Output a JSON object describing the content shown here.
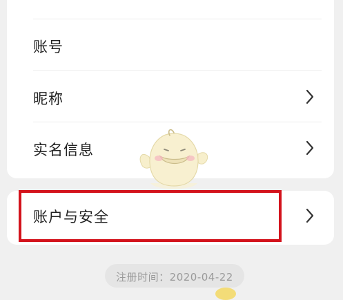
{
  "profile": {
    "items": [
      {
        "label": "账号",
        "has_arrow": false
      },
      {
        "label": "昵称",
        "has_arrow": true
      },
      {
        "label": "实名信息",
        "has_arrow": true
      }
    ],
    "security": {
      "label": "账户与安全",
      "has_arrow": true
    }
  },
  "footer": {
    "register_time": "注册时间：2020-04-22"
  },
  "colors": {
    "highlight": "#d3131c",
    "card": "#ffffff",
    "background": "#f0f0f0",
    "muted_text": "#9a9a9a"
  },
  "icons": [
    "chevron-right-icon",
    "mascot-sticker"
  ]
}
